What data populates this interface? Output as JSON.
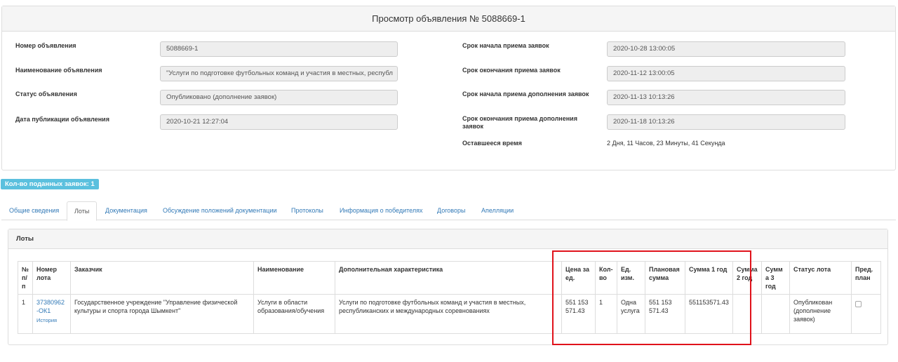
{
  "header": {
    "title": "Просмотр объявления № 5088669-1"
  },
  "fields_left": [
    {
      "label": "Номер объявления",
      "value": "5088669-1"
    },
    {
      "label": "Наименование объявления",
      "value": "\"Услуги по подготовке футбольных команд и участия в местных, республ"
    },
    {
      "label": "Статус объявления",
      "value": "Опубликовано (дополнение заявок)"
    },
    {
      "label": "Дата публикации объявления",
      "value": "2020-10-21 12:27:04"
    }
  ],
  "fields_right": [
    {
      "label": "Срок начала приема заявок",
      "value": "2020-10-28 13:00:05"
    },
    {
      "label": "Срок окончания приема заявок",
      "value": "2020-11-12 13:00:05"
    },
    {
      "label": "Срок начала приема дополнения заявок",
      "value": "2020-11-13 10:13:26"
    },
    {
      "label": "Срок окончания приема дополнения заявок",
      "value": "2020-11-18 10:13:26"
    }
  ],
  "remaining": {
    "label": "Оставшееся время",
    "value": "2 Дня, 11 Часов, 23 Минуты, 41 Секунда"
  },
  "badge": {
    "label": "Кол-во поданных заявок: 1"
  },
  "tabs": [
    {
      "label": "Общие сведения",
      "active": false
    },
    {
      "label": "Лоты",
      "active": true
    },
    {
      "label": "Документация",
      "active": false
    },
    {
      "label": "Обсуждение положений документации",
      "active": false
    },
    {
      "label": "Протоколы",
      "active": false
    },
    {
      "label": "Информация о победителях",
      "active": false
    },
    {
      "label": "Договоры",
      "active": false
    },
    {
      "label": "Апелляции",
      "active": false
    }
  ],
  "lots": {
    "title": "Лоты",
    "columns": [
      "№ п/п",
      "Номер лота",
      "Заказчик",
      "Наименование",
      "Дополнительная характеристика",
      "Цена за ед.",
      "Кол-во",
      "Ед. изм.",
      "Плановая сумма",
      "Сумма 1 год",
      "Сумма 2 год",
      "Сумма 3 год",
      "Статус лота",
      "Пред. план"
    ],
    "rows": [
      {
        "num": "1",
        "lot_number": "37380962-ОК1",
        "history": "История",
        "customer": "Государственное учреждение \"Управление физической культуры и спорта города Шымкент\"",
        "name": "Услуги в области образования/обучения",
        "extra": "Услуги по подготовке футбольных команд и участия в местных, республиканских и международных соревнованиях",
        "price": "551 153 571.43",
        "qty": "1",
        "unit": "Одна услуга",
        "planned": "551 153 571.43",
        "sum1": "551153571.43",
        "sum2": "",
        "sum3": "",
        "status": "Опубликован (дополнение заявок)"
      }
    ]
  },
  "colors": {
    "badge": "#5bc0de",
    "link": "#337ab7",
    "highlight": "#e0121b"
  }
}
